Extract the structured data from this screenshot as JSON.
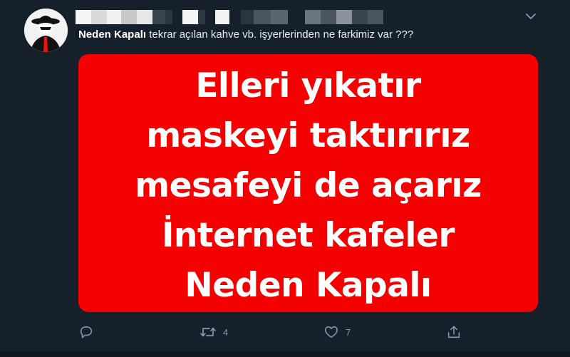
{
  "tweet": {
    "author_name": "Neden Kapalı",
    "text": " tekrar açılan kahve vb. işyerlerinden ne farkimiz var ???",
    "icons": {
      "avatar": "masked-figure-avatar",
      "more": "chevron-down-icon",
      "reply": "reply-icon",
      "retweet": "retweet-icon",
      "like": "heart-icon",
      "share": "share-icon"
    },
    "media": {
      "lines": [
        "Elleri yıkatır",
        "maskeyi taktırırız",
        "mesafeyi de açarız",
        "İnternet kafeler",
        "Neden Kapalı"
      ],
      "background_color": "#f30000",
      "text_color": "#ffffff"
    },
    "actions": {
      "retweet_count": "4",
      "like_count": "7"
    }
  },
  "colors": {
    "background": "#15202b",
    "text": "#e6ecf0",
    "muted": "#8899a6"
  }
}
